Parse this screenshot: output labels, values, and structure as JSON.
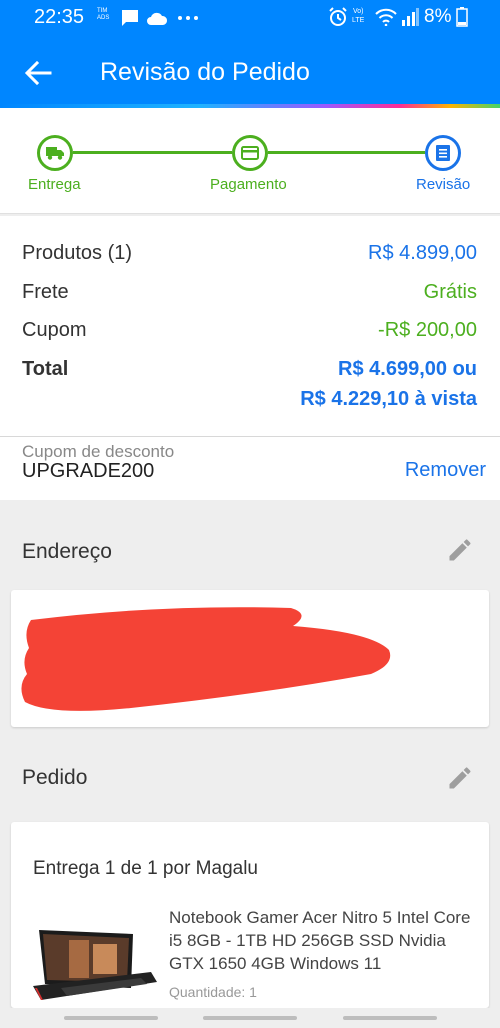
{
  "colors": {
    "primary": "#0086ff",
    "accent_blue": "#1a73e8",
    "success_green": "#4caf1f",
    "redaction_red": "#f44336"
  },
  "status_bar": {
    "time": "22:35",
    "lte_top": "Vo)",
    "lte_bottom": "LTE",
    "battery": "8%",
    "icons": [
      "message-icon",
      "cloud-icon",
      "more-icon",
      "alarm-icon",
      "wifi-icon",
      "signal-icon",
      "battery-icon"
    ]
  },
  "app_bar": {
    "title": "Revisão do Pedido"
  },
  "stepper": {
    "steps": [
      {
        "label": "Entrega",
        "icon": "truck-icon"
      },
      {
        "label": "Pagamento",
        "icon": "card-icon"
      },
      {
        "label": "Revisão",
        "icon": "document-icon"
      }
    ]
  },
  "summary": {
    "products_label": "Produtos (1)",
    "products_value": "R$ 4.899,00",
    "shipping_label": "Frete",
    "shipping_value": "Grátis",
    "coupon_label": "Cupom",
    "coupon_value": "-R$ 200,00",
    "total_label": "Total",
    "total_value_line1": "R$ 4.699,00 ou",
    "total_value_line2": "R$ 4.229,10 à vista"
  },
  "coupon": {
    "label": "Cupom de desconto",
    "code": "UPGRADE200",
    "remove_label": "Remover"
  },
  "address": {
    "title": "Endereço"
  },
  "order": {
    "title": "Pedido",
    "delivery_title": "Entrega 1 de 1 por Magalu",
    "product_name": "Notebook Gamer Acer Nitro 5 Intel Core i5 8GB - 1TB HD 256GB SSD Nvidia GTX 1650 4GB Windows 11",
    "quantity": "Quantidade:  1"
  }
}
